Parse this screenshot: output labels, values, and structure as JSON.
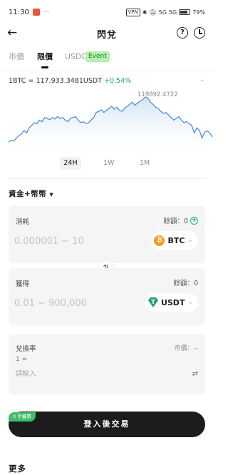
{
  "status_bar": {
    "time": "11:30",
    "notif_dots": "···",
    "vpn_label": "VPN",
    "signal_1": "5G",
    "signal_2": "5G",
    "battery_percent": "79%"
  },
  "header": {
    "title": "閃兌"
  },
  "tabs": [
    {
      "label": "市價",
      "active": false
    },
    {
      "label": "限價",
      "active": true
    },
    {
      "label": "USDD",
      "active": false,
      "badge": "Event"
    }
  ],
  "price_info": {
    "pair_price": "1BTC = 117,933.3481USDT",
    "change": "+0.54%",
    "peak_label": "119892.4722"
  },
  "chart_data": {
    "type": "area",
    "title": "",
    "peak_value": 119892.4722,
    "y_relative": [
      0.12,
      0.16,
      0.14,
      0.2,
      0.25,
      0.28,
      0.35,
      0.3,
      0.4,
      0.45,
      0.5,
      0.48,
      0.55,
      0.52,
      0.6,
      0.58,
      0.56,
      0.6,
      0.57,
      0.62,
      0.58,
      0.6,
      0.55,
      0.52,
      0.58,
      0.6,
      0.62,
      0.55,
      0.5,
      0.52,
      0.48,
      0.5,
      0.55,
      0.6,
      0.7,
      0.72,
      0.75,
      0.7,
      0.74,
      0.78,
      0.82,
      0.76,
      0.8,
      0.74,
      0.72,
      0.78,
      0.82,
      0.86,
      0.9,
      0.84,
      0.88,
      0.92,
      0.95,
      1.0,
      0.98,
      0.9,
      0.86,
      0.8,
      0.78,
      0.72,
      0.68,
      0.7,
      0.65,
      0.6,
      0.55,
      0.58,
      0.62,
      0.55,
      0.5,
      0.52,
      0.48,
      0.45,
      0.3,
      0.4,
      0.35,
      0.2,
      0.32,
      0.34,
      0.3,
      0.22
    ],
    "line_color": "#3b7fd6",
    "fill_color": "#cfe2f7",
    "grid": false
  },
  "ranges": [
    {
      "label": "24H",
      "active": true
    },
    {
      "label": "1W",
      "active": false
    },
    {
      "label": "1M",
      "active": false
    }
  ],
  "asset_selector": {
    "label": "資金+幣幣",
    "caret": "▼"
  },
  "consume": {
    "label": "消耗",
    "balance": "餘額：0",
    "placeholder": "0.000001 ~ 10",
    "coin": "BTC",
    "coin_icon_glyph": "₿"
  },
  "receive": {
    "label": "獲得",
    "balance": "餘額：0",
    "placeholder": "0.01 ~ 900,000",
    "coin": "USDT",
    "coin_icon_glyph": "T"
  },
  "rate": {
    "label": "兌換率",
    "market": "市價：--",
    "prefix": "1 =",
    "placeholder": "請輸入"
  },
  "action": {
    "fee_badge": "0 手續費",
    "button_label": "登入後交易"
  },
  "more": {
    "heading": "更多"
  },
  "icons": {
    "back": "back-arrow-icon",
    "help": "help-icon",
    "history": "history-icon",
    "swap": "swap-icon",
    "add": "add-icon"
  },
  "colors": {
    "accent_green": "#1fae5e",
    "event_badge_bg": "#b5f0b0",
    "button_bg": "#1c1c1c",
    "btc_orange": "#f49c1f",
    "usdt_green": "#26a17b"
  }
}
